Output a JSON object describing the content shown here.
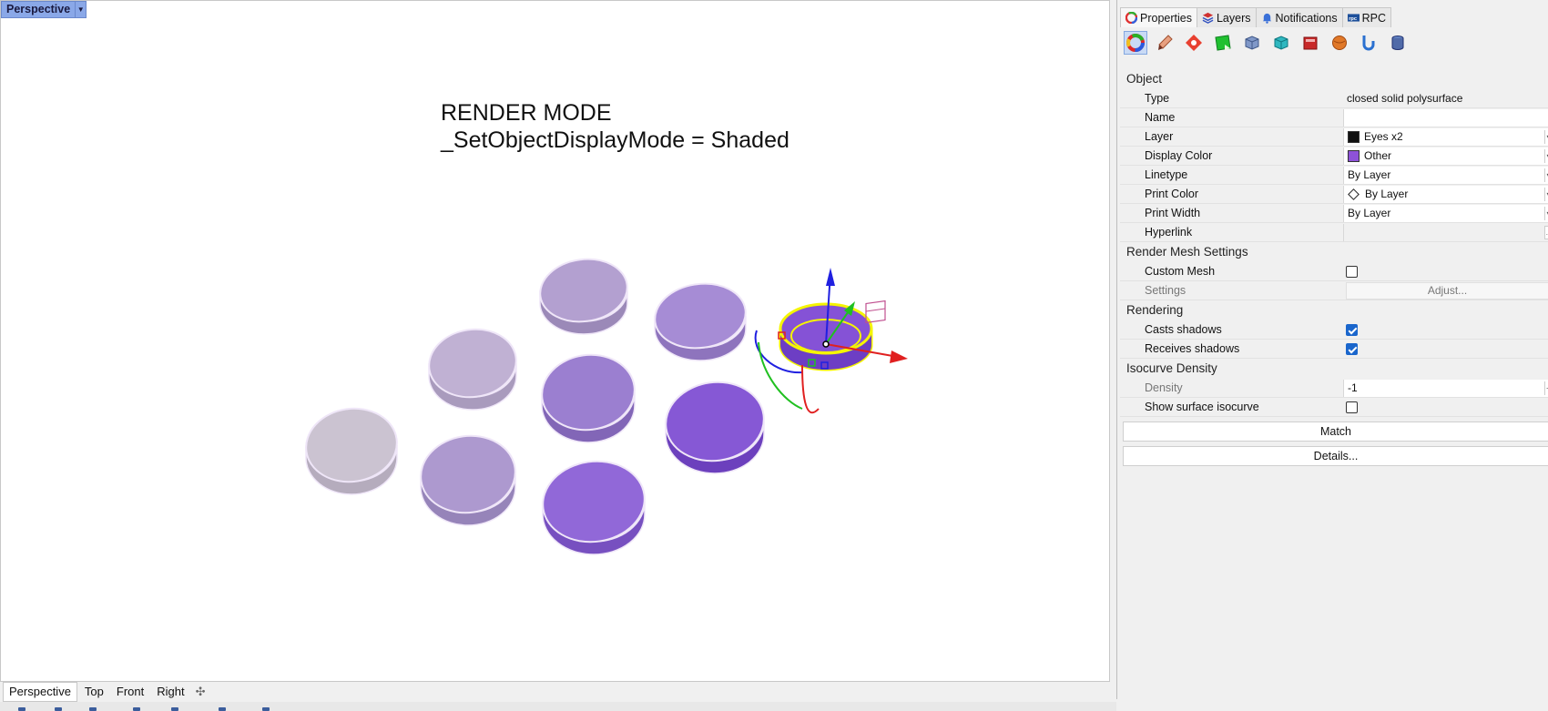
{
  "viewport": {
    "name": "Perspective",
    "text_line1": "RENDER MODE",
    "text_line2": "_SetObjectDisplayMode = Shaded"
  },
  "viewport_tabs": [
    "Perspective",
    "Top",
    "Front",
    "Right"
  ],
  "panel": {
    "tabs": [
      {
        "label": "Properties",
        "icon": "color-wheel-icon"
      },
      {
        "label": "Layers",
        "icon": "layers-icon"
      },
      {
        "label": "Notifications",
        "icon": "bell-icon"
      },
      {
        "label": "RPC",
        "icon": "rpc-icon"
      }
    ],
    "sections": {
      "object": "Object",
      "render_mesh": "Render Mesh Settings",
      "rendering": "Rendering",
      "isocurve": "Isocurve Density"
    },
    "object": {
      "type_label": "Type",
      "type_value": "closed solid polysurface",
      "name_label": "Name",
      "name_value": "",
      "layer_label": "Layer",
      "layer_value": "Eyes x2",
      "layer_color": "#111111",
      "display_color_label": "Display Color",
      "display_color_value": "Other",
      "display_color": "#8e52d8",
      "linetype_label": "Linetype",
      "linetype_value": "By Layer",
      "print_color_label": "Print Color",
      "print_color_value": "By Layer",
      "print_width_label": "Print Width",
      "print_width_value": "By Layer",
      "hyperlink_label": "Hyperlink"
    },
    "render_mesh": {
      "custom_mesh_label": "Custom Mesh",
      "custom_mesh": false,
      "settings_label": "Settings",
      "adjust_label": "Adjust..."
    },
    "rendering": {
      "casts_label": "Casts shadows",
      "casts": true,
      "receives_label": "Receives shadows",
      "receives": true
    },
    "isocurve": {
      "density_label": "Density",
      "density_value": "-1",
      "show_label": "Show surface isocurve",
      "show": false
    },
    "match_label": "Match",
    "details_label": "Details..."
  },
  "colors": {
    "selection": "#f5f500",
    "gumball_x": "#e02020",
    "gumball_y": "#20c020",
    "gumball_z": "#2020e0"
  }
}
